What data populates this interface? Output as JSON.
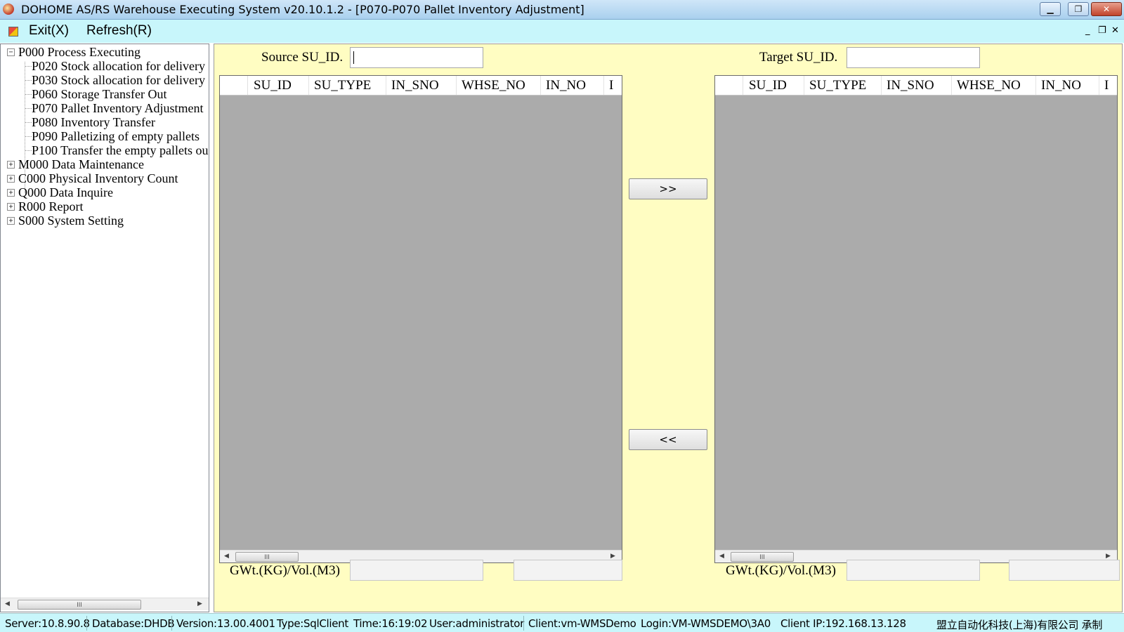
{
  "window": {
    "title": "DOHOME AS/RS Warehouse Executing System v20.10.1.2 - [P070-P070 Pallet Inventory Adjustment]",
    "minimize": "▁",
    "restore": "❐",
    "close": "✕"
  },
  "menu": {
    "exit": "Exit(X)",
    "refresh": "Refresh(R)",
    "mdi_min": "_",
    "mdi_restore": "❐",
    "mdi_close": "✕"
  },
  "tree": {
    "root": {
      "label": "P000 Process Executing",
      "expander": "−"
    },
    "children": [
      {
        "label": "P020 Stock allocation for delivery"
      },
      {
        "label": "P030 Stock allocation for delivery"
      },
      {
        "label": "P060 Storage Transfer Out"
      },
      {
        "label": "P070 Pallet Inventory Adjustment"
      },
      {
        "label": "P080 Inventory Transfer"
      },
      {
        "label": "P090 Palletizing of empty pallets"
      },
      {
        "label": "P100 Transfer the empty pallets ou"
      }
    ],
    "collapsed": [
      {
        "label": "M000 Data Maintenance",
        "expander": "+"
      },
      {
        "label": "C000 Physical Inventory Count",
        "expander": "+"
      },
      {
        "label": "Q000 Data Inquire",
        "expander": "+"
      },
      {
        "label": "R000 Report",
        "expander": "+"
      },
      {
        "label": "S000 System Setting",
        "expander": "+"
      }
    ]
  },
  "scroll": {
    "left_arrow": "◀",
    "right_arrow": "▶",
    "thumb_grip": "III"
  },
  "source": {
    "label": "Source SU_ID.",
    "value": "",
    "columns": [
      "SU_ID",
      "SU_TYPE",
      "IN_SNO",
      "WHSE_NO",
      "IN_NO",
      "I"
    ],
    "weight_label": "GWt.(KG)/Vol.(M3)",
    "weight_value": "",
    "volume_value": ""
  },
  "target": {
    "label": "Target SU_ID.",
    "value": "",
    "columns": [
      "SU_ID",
      "SU_TYPE",
      "IN_SNO",
      "WHSE_NO",
      "IN_NO",
      "I"
    ],
    "weight_label": "GWt.(KG)/Vol.(M3)",
    "weight_value": "",
    "volume_value": ""
  },
  "buttons": {
    "move_right": ">>",
    "move_left": "<<"
  },
  "status": {
    "server": "Server:10.8.90.8",
    "database": "Database:DHDB",
    "version": "Version:13.00.4001",
    "type": "Type:SqlClient",
    "time": "Time:16:19:02",
    "user": "User:administrator",
    "client": "Client:vm-WMSDemo",
    "login": "Login:VM-WMSDEMO\\3A0",
    "client_ip": "Client IP:192.168.13.128",
    "vendor": "盟立自动化科技(上海)有限公司 承制"
  }
}
